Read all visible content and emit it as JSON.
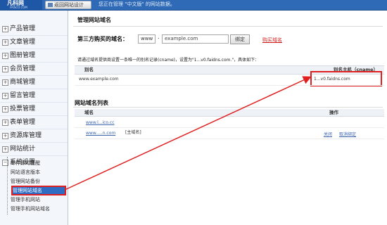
{
  "topbar": {
    "logo": "凡科网",
    "logo_sub": "FAISCO.COM",
    "back_button": "返回网站设计",
    "note": "您正在管理 \"中文版\" 的网站数据。"
  },
  "sidebar": {
    "items": [
      {
        "label": "产品管理"
      },
      {
        "label": "文章管理"
      },
      {
        "label": "图册管理"
      },
      {
        "label": "会员管理"
      },
      {
        "label": "商城管理"
      },
      {
        "label": "留言管理"
      },
      {
        "label": "投票管理"
      },
      {
        "label": "表单管理"
      },
      {
        "label": "资源库管理"
      },
      {
        "label": "网站统计"
      },
      {
        "label": "系统设置"
      }
    ],
    "subitems": [
      {
        "label": "邮件即时提醒"
      },
      {
        "label": "网站语言版本"
      },
      {
        "label": "管理网站备份"
      },
      {
        "label": "管理网站域名"
      },
      {
        "label": "管理手机网站"
      },
      {
        "label": "管理手机网站域名"
      }
    ]
  },
  "main": {
    "title": "管理网站域名",
    "third_party_label": "第三方购买的域名：",
    "www_value": "www",
    "domain_placeholder": "example.com",
    "bind_button": "绑定",
    "buy_link": "购买域名",
    "notice": "请通过域名提供商设置一条唯一的别名记录(cname)，设置为\"1...v0.faidns.com.\"，具体如下：",
    "cname_table": {
      "headers": [
        "别名",
        "别名主机（cname）"
      ],
      "rows": [
        [
          "www.example.com",
          "1...v0.faidns.com"
        ]
      ]
    },
    "domain_list_title": "网站域名列表",
    "domain_table": {
      "headers": [
        "域名",
        "操作"
      ],
      "rows": [
        {
          "domain": "www.l...ico.cc",
          "tag": "",
          "actions": []
        },
        {
          "domain": "www.....n.com",
          "tag": "[主域名]",
          "actions": [
            "关闭",
            "取消绑定"
          ]
        }
      ]
    }
  },
  "colors": {
    "topbar": "#2f6ab7",
    "highlight": "#e02020",
    "active_item": "#2f6cc4",
    "link": "#3b64ad"
  }
}
